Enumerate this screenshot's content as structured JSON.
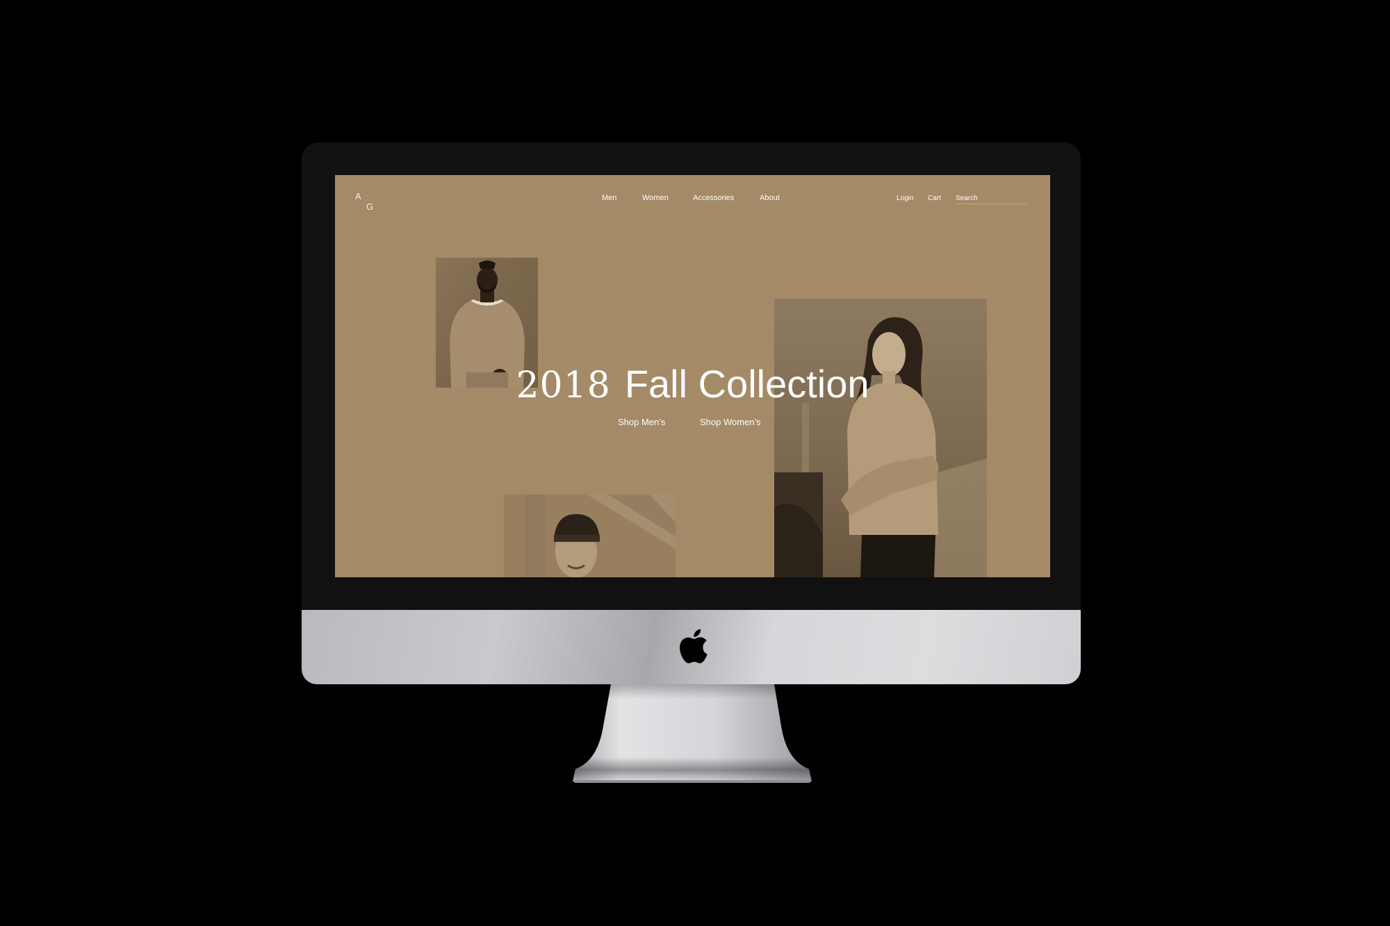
{
  "site": {
    "logo": {
      "letter_top": "A",
      "letter_bottom": "G"
    },
    "nav": {
      "items": [
        {
          "label": "Men"
        },
        {
          "label": "Women"
        },
        {
          "label": "Accessories"
        },
        {
          "label": "About"
        }
      ]
    },
    "utility": {
      "login": "Login",
      "cart": "Cart",
      "search_placeholder": "Search"
    },
    "hero": {
      "year": "2018",
      "title": "Fall Collection",
      "links": {
        "men": "Shop Men’s",
        "women": "Shop Women’s"
      }
    },
    "colors": {
      "background": "#a48a66",
      "text": "#ffffff",
      "search_underline": "#c8aa6e"
    }
  },
  "device": {
    "icons": [
      "apple-logo-icon"
    ]
  }
}
